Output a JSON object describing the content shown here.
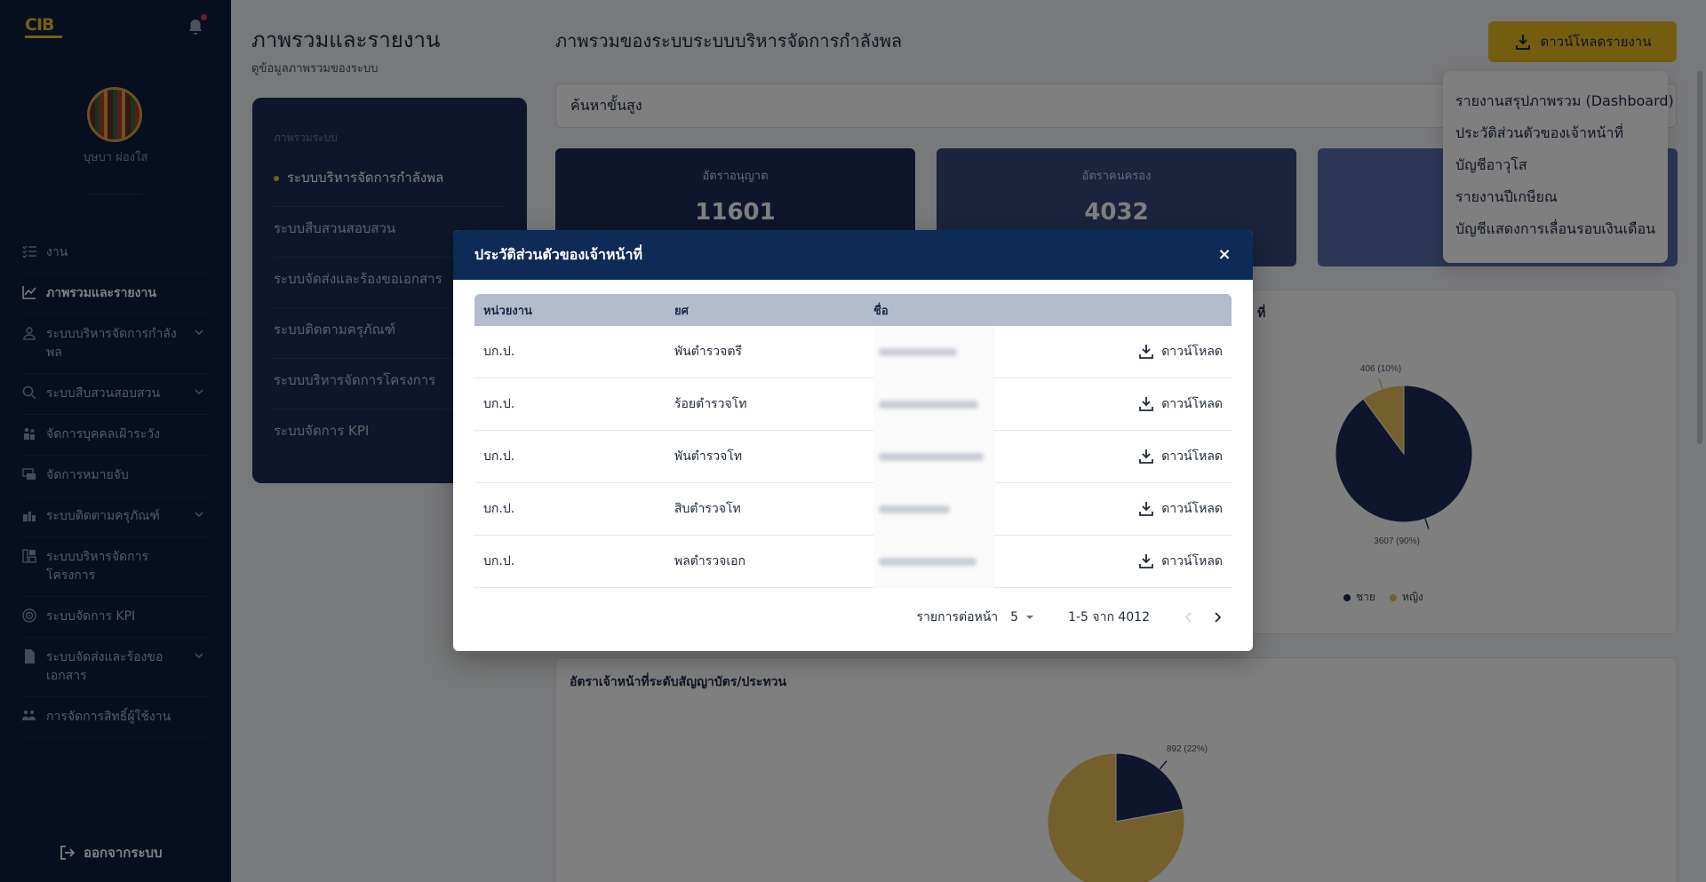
{
  "app": {
    "logo_text": "CIB"
  },
  "user": {
    "name": "บุษบา ผ่องใส"
  },
  "sidebar": {
    "items": [
      {
        "label": "งาน",
        "icon": "task-list-icon",
        "active": false,
        "expandable": false
      },
      {
        "label": "ภาพรวมและรายงาน",
        "icon": "chart-line-icon",
        "active": true,
        "expandable": false
      },
      {
        "label": "ระบบบริหารจัดการกำลังพล",
        "icon": "person-badge-icon",
        "active": false,
        "expandable": true
      },
      {
        "label": "ระบบสืบสวนสอบสวน",
        "icon": "search-icon",
        "active": false,
        "expandable": true
      },
      {
        "label": "จัดการบุคคลเฝ้าระวัง",
        "icon": "people-watch-icon",
        "active": false,
        "expandable": false
      },
      {
        "label": "จัดการหมายจับ",
        "icon": "warrant-icon",
        "active": false,
        "expandable": false
      },
      {
        "label": "ระบบติดตามครุภัณฑ์",
        "icon": "equipment-icon",
        "active": false,
        "expandable": true
      },
      {
        "label": "ระบบบริหารจัดการโครงการ",
        "icon": "project-icon",
        "active": false,
        "expandable": false
      },
      {
        "label": "ระบบจัดการ KPI",
        "icon": "target-icon",
        "active": false,
        "expandable": false
      },
      {
        "label": "ระบบจัดส่งและร้องขอเอกสาร",
        "icon": "document-icon",
        "active": false,
        "expandable": true
      },
      {
        "label": "การจัดการสิทธิ์ผู้ใช้งาน",
        "icon": "user-permission-icon",
        "active": false,
        "expandable": false
      }
    ],
    "logout_label": "ออกจากระบบ"
  },
  "page": {
    "title": "ภาพรวมและรายงาน",
    "subtitle": "ดูข้อมูลภาพรวมของระบบ"
  },
  "subnav": {
    "header": "ภาพรวมระบบ",
    "items": [
      {
        "label": "ระบบบริหารจัดการกำลังพล",
        "active": true
      },
      {
        "label": "ระบบสืบสวนสอบสวน",
        "active": false
      },
      {
        "label": "ระบบจัดส่งและร้องขอเอกสาร",
        "active": false
      },
      {
        "label": "ระบบติดตามครุภัณฑ์",
        "active": false
      },
      {
        "label": "ระบบบริหารจัดการโครงการ",
        "active": false
      },
      {
        "label": "ระบบจัดการ KPI",
        "active": false
      }
    ]
  },
  "main": {
    "title": "ภาพรวมของระบบระบบบริหารจัดการกำลังพล",
    "download_report_label": "ดาวน์โหลดรายงาน",
    "search_label": "ค้นหาขั้นสูง",
    "stats": [
      {
        "label": "อัตราอนุญาต",
        "value": "11601"
      },
      {
        "label": "อัตราคนครอง",
        "value": "4032"
      },
      {
        "label": "",
        "value": ""
      }
    ],
    "panel1_title_fragment": "ที่",
    "panel2_title": "อัตราเจ้าหน้าที่ระดับสัญญาบัตร/ประทวน"
  },
  "chart_data": [
    {
      "type": "pie",
      "title": "",
      "categories": [
        "ชาย",
        "หญิง"
      ],
      "values": [
        3607,
        406
      ],
      "labels": [
        "3607 (90%)",
        "406 (10%)"
      ],
      "colors": [
        "#1f2d57",
        "#e8c15a"
      ],
      "legend": "bottom"
    },
    {
      "type": "pie",
      "title": "อัตราเจ้าหน้าที่ระดับสัญญาบัตร/ประทวน",
      "categories": [
        "",
        ""
      ],
      "values": [
        892,
        3140
      ],
      "labels": [
        "892 (22%)",
        ""
      ],
      "colors": [
        "#1f2d57",
        "#e8c15a"
      ]
    }
  ],
  "dropdown": {
    "options": [
      "รายงานสรุปภาพรวม (Dashboard)",
      "ประวัติส่วนตัวของเจ้าหน้าที่",
      "บัญชีอาวุโส",
      "รายงานปีเกษียณ",
      "บัญชีแสดงการเลื่อนรอบเงินเดือน"
    ]
  },
  "modal": {
    "title": "ประวัติส่วนตัวของเจ้าหน้าที่",
    "close_symbol": "×",
    "columns": [
      "หน่วยงาน",
      "ยศ",
      "ชื่อ"
    ],
    "rows": [
      {
        "unit": "บก.ป.",
        "rank": "พันตำรวจตรี",
        "download_label": "ดาวน์โหลด"
      },
      {
        "unit": "บก.ป.",
        "rank": "ร้อยตำรวจโท",
        "download_label": "ดาวน์โหลด"
      },
      {
        "unit": "บก.ป.",
        "rank": "พันตำรวจโท",
        "download_label": "ดาวน์โหลด"
      },
      {
        "unit": "บก.ป.",
        "rank": "สิบตำรวจโท",
        "download_label": "ดาวน์โหลด"
      },
      {
        "unit": "บก.ป.",
        "rank": "พลตำรวจเอก",
        "download_label": "ดาวน์โหลด"
      }
    ],
    "pagination": {
      "rows_per_page_label": "รายการต่อหน้า",
      "rows_per_page": "5",
      "range_text": "1-5 จาก 4012"
    }
  },
  "colors": {
    "sidebar_bg": "#0e1e3c",
    "accent_yellow": "#e8ba1e",
    "modal_header": "#0e2a56",
    "table_header": "#b3bccb"
  }
}
